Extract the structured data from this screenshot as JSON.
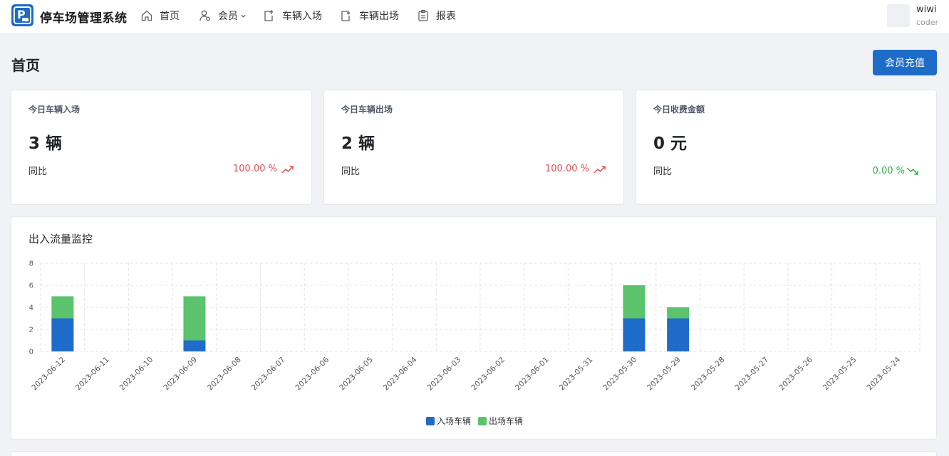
{
  "header": {
    "app_title": "停车场管理系统",
    "nav": [
      {
        "label": "首页",
        "icon": "home-icon"
      },
      {
        "label": "会员",
        "icon": "member-icon",
        "has_dropdown": true
      },
      {
        "label": "车辆入场",
        "icon": "vehicle-entry-icon"
      },
      {
        "label": "车辆出场",
        "icon": "vehicle-exit-icon"
      },
      {
        "label": "报表",
        "icon": "report-icon"
      }
    ],
    "user": {
      "name": "wiwi",
      "role": "coder"
    }
  },
  "page": {
    "title": "首页",
    "recharge_button": "会员充值"
  },
  "stats": [
    {
      "label": "今日车辆入场",
      "value": "3 辆",
      "compare_label": "同比",
      "percent": "100.00 %",
      "trend": "up"
    },
    {
      "label": "今日车辆出场",
      "value": "2 辆",
      "compare_label": "同比",
      "percent": "100.00 %",
      "trend": "up"
    },
    {
      "label": "今日收费金额",
      "value": "0 元",
      "compare_label": "同比",
      "percent": "0.00 %",
      "trend": "down"
    }
  ],
  "colors": {
    "primary": "#1e6bc8",
    "entry_series": "#1f6bc9",
    "exit_series": "#5ac36b",
    "up": "#e0505a",
    "down": "#2fb14a"
  },
  "chart_data": {
    "type": "bar",
    "stacked": true,
    "title": "出入流量监控",
    "categories": [
      "2023-06-12",
      "2023-06-11",
      "2023-06-10",
      "2023-06-09",
      "2023-06-08",
      "2023-06-07",
      "2023-06-06",
      "2023-06-05",
      "2023-06-04",
      "2023-06-03",
      "2023-06-02",
      "2023-06-01",
      "2023-05-31",
      "2023-05-30",
      "2023-05-29",
      "2023-05-28",
      "2023-05-27",
      "2023-05-26",
      "2023-05-25",
      "2023-05-24"
    ],
    "series": [
      {
        "name": "入场车辆",
        "color": "#1f6bc9",
        "values": [
          3,
          0,
          0,
          1,
          0,
          0,
          0,
          0,
          0,
          0,
          0,
          0,
          0,
          3,
          3,
          0,
          0,
          0,
          0,
          0
        ]
      },
      {
        "name": "出场车辆",
        "color": "#5ac36b",
        "values": [
          2,
          0,
          0,
          4,
          0,
          0,
          0,
          0,
          0,
          0,
          0,
          0,
          0,
          3,
          1,
          0,
          0,
          0,
          0,
          0
        ]
      }
    ],
    "ylim": [
      0,
      8
    ],
    "yticks": [
      0,
      2,
      4,
      6,
      8
    ],
    "grid": true,
    "legend_position": "bottom-center"
  }
}
